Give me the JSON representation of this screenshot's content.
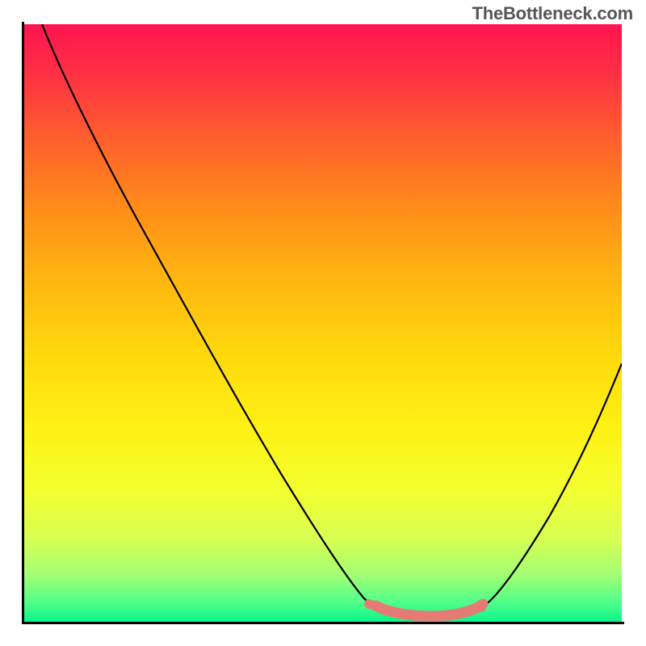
{
  "watermark": "TheBottleneck.com",
  "chart_data": {
    "type": "line",
    "title": "",
    "xlabel": "",
    "ylabel": "",
    "xlim": [
      0,
      100
    ],
    "ylim": [
      0,
      100
    ],
    "series": [
      {
        "name": "main-curve",
        "x": [
          3,
          10,
          20,
          30,
          40,
          50,
          55,
          58,
          60,
          63,
          65,
          68,
          70,
          73,
          76,
          80,
          85,
          90,
          95,
          100
        ],
        "y": [
          100,
          88,
          73,
          58,
          42,
          26,
          18,
          12,
          8,
          4,
          2,
          1,
          1,
          1,
          2,
          6,
          14,
          25,
          38,
          52
        ],
        "color": "#000000"
      },
      {
        "name": "highlight-segment",
        "x": [
          58,
          60,
          63,
          65,
          68,
          70,
          73,
          76
        ],
        "y": [
          5,
          4,
          3,
          2.5,
          2,
          2,
          2,
          3
        ],
        "color": "#e77a74"
      }
    ],
    "background_gradient": {
      "stops": [
        {
          "offset": 0,
          "color": "#ff1550"
        },
        {
          "offset": 50,
          "color": "#ffd80c"
        },
        {
          "offset": 100,
          "color": "#07f589"
        }
      ]
    }
  }
}
